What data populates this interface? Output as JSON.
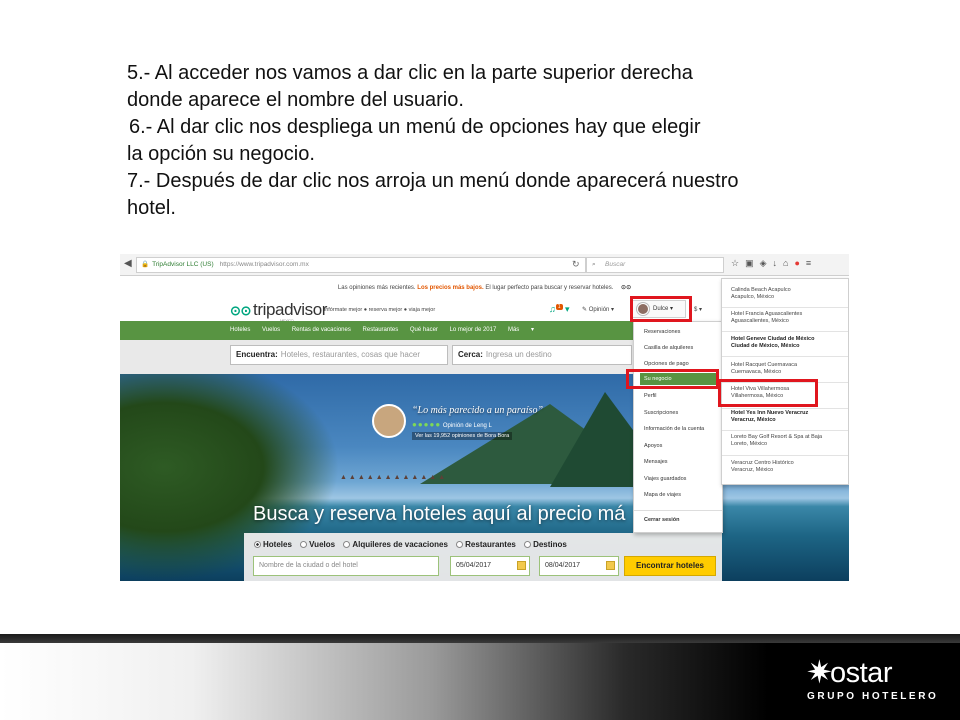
{
  "instructions": [
    "5.- Al acceder nos vamos a dar clic en la parte superior derecha",
    "donde aparece el nombre del usuario.",
    "6.- Al dar clic nos despliega un menú de opciones hay que elegir",
    "la opción su negocio.",
    "7.- Después de dar clic nos arroja un menú donde aparecerá nuestro",
    "hotel."
  ],
  "browser": {
    "site_label": "TripAdvisor LLC (US)",
    "url": "https://www.tripadvisor.com.mx",
    "search_placeholder": "Buscar"
  },
  "tripadvisor": {
    "banner_before": "Las opiniones más recientes.",
    "banner_highlight": "Los precios más bajos.",
    "banner_after": "El lugar perfecto para buscar y reservar hoteles.",
    "logo": "tripadvisor",
    "logo_sub": "MEXICO",
    "tagline": "infórmate mejor ● reserva mejor ● viaja mejor",
    "notif_count": "1",
    "opinion_label": "Opinión",
    "user_label": "Dulce",
    "currency": "$",
    "nav": [
      "Hoteles",
      "Vuelos",
      "Rentas de vacaciones",
      "Restaurantes",
      "Qué hacer",
      "Lo mejor de 2017",
      "Más"
    ],
    "find_label": "Encuentra:",
    "find_placeholder": "Hoteles, restaurantes, cosas que hacer",
    "near_label": "Cerca:",
    "near_placeholder": "Ingresa un destino",
    "hero_quote": "“Lo más parecido a un paraíso”",
    "hero_rating_by": "Opinión de Leng L",
    "hero_reviews": "Ver las 19,952 opiniones de Bora Bora",
    "hero_title": "Busca y reserva hoteles aquí al precio má",
    "booking_options": [
      "Hoteles",
      "Vuelos",
      "Alquileres de vacaciones",
      "Restaurantes",
      "Destinos"
    ],
    "city_placeholder": "Nombre de la ciudad o del hotel",
    "checkin": "05/04/2017",
    "checkout": "08/04/2017",
    "search_button": "Encontrar hoteles"
  },
  "user_menu": [
    "Reservaciones",
    "Casilla de alquileres",
    "Opciones de pago",
    "Su negocio",
    "Perfil",
    "Suscripciones",
    "Información de la cuenta",
    "Apoyos",
    "Mensajes",
    "Viajes guardados",
    "Mapa de viajes",
    "Cerrar sesión"
  ],
  "hotel_menu": [
    {
      "name": "Calinda Beach Acapulco",
      "city": "Acapulco, México"
    },
    {
      "name": "Hotel Francia Aguascalientes",
      "city": "Aguascalientes, México"
    },
    {
      "name": "Hotel Geneve Ciudad de México",
      "city": "Ciudad de México, México"
    },
    {
      "name": "Hotel Racquet Cuernavaca",
      "city": "Cuernavaca, México"
    },
    {
      "name": "Hotel Viva Villahermosa",
      "city": "Villahermosa, México"
    },
    {
      "name": "Hotel Yes Inn Nuevo Veracruz",
      "city": "Veracruz, México"
    },
    {
      "name": "Loreto Bay Golf Resort & Spa at Baja",
      "city": "Loreto, México"
    },
    {
      "name": "Veracruz Centro Histórico",
      "city": "Veracruz, México"
    }
  ],
  "brand": {
    "name": "ostar",
    "subtitle": "GRUPO HOTELERO"
  },
  "colors": {
    "highlight_box": "#e0161e",
    "ta_green": "#589442",
    "ta_orange": "#e25600",
    "button_yellow": "#ffcc00"
  }
}
